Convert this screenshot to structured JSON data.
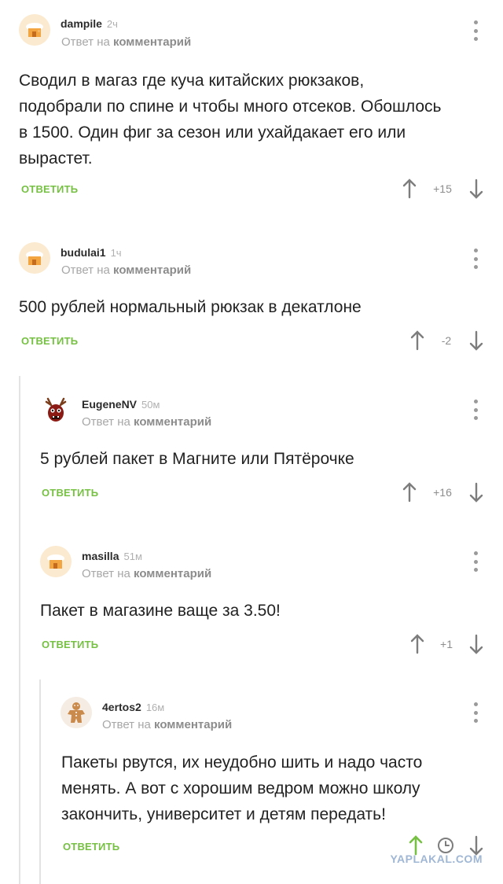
{
  "comments": [
    {
      "author": "dampile",
      "time": "2ч",
      "reply_prefix": "Ответ на",
      "reply_target": "комментарий",
      "text_lines": [
        "Сводил в магаз где куча китайских рюкзаков,",
        "подобрали по спине и чтобы много отсеков. Обошлось",
        "в 1500. Один фиг за сезон или ухайдакает его или",
        "вырастет."
      ],
      "reply_label": "ОТВЕТИТЬ",
      "score": "+15",
      "avatar": "house-avatar-icon"
    },
    {
      "author": "budulai1",
      "time": "1ч",
      "reply_prefix": "Ответ на",
      "reply_target": "комментарий",
      "text_lines": [
        "500 рублей нормальный рюкзак в декатлоне"
      ],
      "reply_label": "ОТВЕТИТЬ",
      "score": "-2",
      "avatar": "house-avatar-icon"
    },
    {
      "author": "EugeneNV",
      "time": "50м",
      "reply_prefix": "Ответ на",
      "reply_target": "комментарий",
      "text_lines": [
        "5 рублей пакет в Магните или Пятёрочке"
      ],
      "reply_label": "ОТВЕТИТЬ",
      "score": "+16",
      "avatar": "reindeer-avatar-icon"
    },
    {
      "author": "masilla",
      "time": "51м",
      "reply_prefix": "Ответ на",
      "reply_target": "комментарий",
      "text_lines": [
        "Пакет в магазине ваще за 3.50!"
      ],
      "reply_label": "ОТВЕТИТЬ",
      "score": "+1",
      "avatar": "house-avatar-icon"
    },
    {
      "author": "4ertos2",
      "time": "16м",
      "reply_prefix": "Ответ на",
      "reply_target": "комментарий",
      "text_lines": [
        "Пакеты рвутся, их неудобно шить и надо часто",
        "менять. А вот с хорошим ведром можно школу",
        "закончить, университет и детям передать!"
      ],
      "reply_label": "ОТВЕТИТЬ",
      "score_icon": "clock-icon",
      "avatar": "gingerbread-avatar-icon"
    }
  ],
  "watermark": "YAPLAKAL.COM",
  "colors": {
    "accent": "#76c043",
    "upvote_active": "#76c043",
    "meta": "#a7a7a7",
    "thread_line": "#e3e3e3"
  }
}
